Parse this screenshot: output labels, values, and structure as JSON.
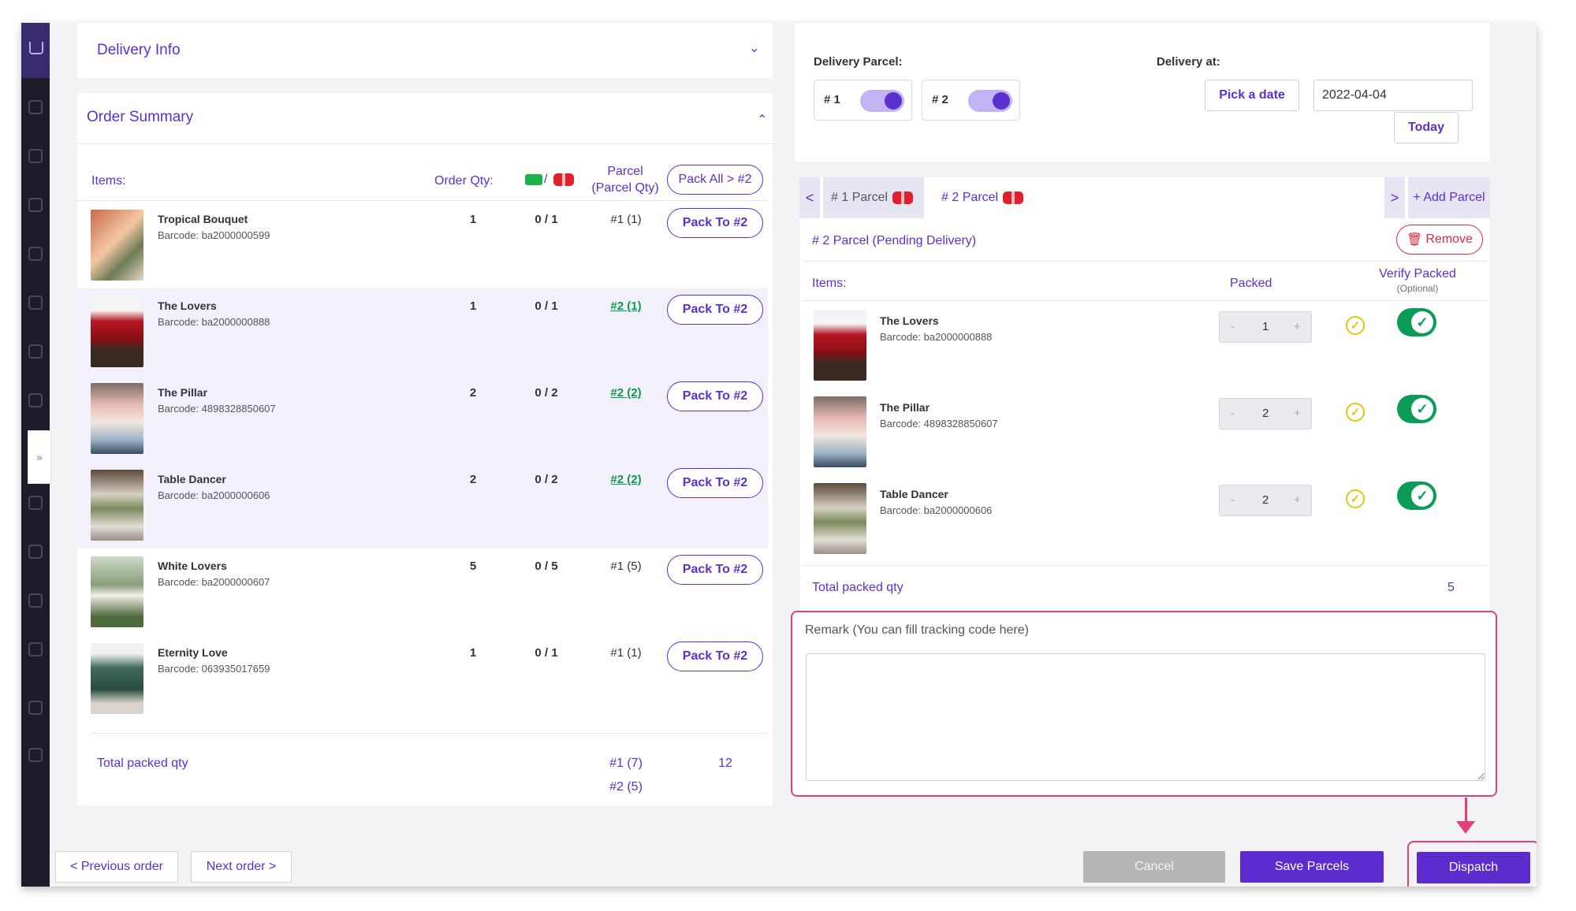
{
  "delivery_info": {
    "title": "Delivery Info"
  },
  "order_summary": {
    "title": "Order Summary",
    "headers": {
      "items": "Items:",
      "order_qty": "Order Qty:",
      "slash": "/",
      "parcel": "Parcel",
      "parcel_qty": "(Parcel Qty)"
    },
    "pack_all_label": "Pack All > #2",
    "items": [
      {
        "name": "Tropical Bouquet",
        "barcode": "Barcode: ba2000000599",
        "qty": "1",
        "packed": "0 / 1",
        "parcel": "#1 (1)",
        "pack_label": "Pack To #2"
      },
      {
        "name": "The Lovers",
        "barcode": "Barcode: ba2000000888",
        "qty": "1",
        "packed": "0 / 1",
        "parcel": "#2 (1)",
        "pack_label": "Pack To #2"
      },
      {
        "name": "The Pillar",
        "barcode": "Barcode: 4898328850607",
        "qty": "2",
        "packed": "0 / 2",
        "parcel": "#2 (2)",
        "pack_label": "Pack To #2"
      },
      {
        "name": "Table Dancer",
        "barcode": "Barcode: ba2000000606",
        "qty": "2",
        "packed": "0 / 2",
        "parcel": "#2 (2)",
        "pack_label": "Pack To #2"
      },
      {
        "name": "White Lovers",
        "barcode": "Barcode: ba2000000607",
        "qty": "5",
        "packed": "0 / 5",
        "parcel": "#1 (5)",
        "pack_label": "Pack To #2"
      },
      {
        "name": "Eternity Love",
        "barcode": "Barcode: 063935017659",
        "qty": "1",
        "packed": "0 / 1",
        "parcel": "#1 (1)",
        "pack_label": "Pack To #2"
      }
    ],
    "total_label": "Total packed qty",
    "total_parcel_1": "#1 (7)",
    "total_parcel_2": "#2 (5)",
    "total_value": "12"
  },
  "delivery": {
    "parcel_label": "Delivery Parcel:",
    "toggle_1": "# 1",
    "toggle_2": "# 2",
    "at_label": "Delivery at:",
    "pick_date": "Pick a date",
    "date_value": "2022-04-04",
    "today": "Today"
  },
  "parcels": {
    "tab_1": "# 1 Parcel",
    "tab_2": "# 2 Parcel",
    "add_parcel": "+ Add Parcel",
    "prev_symbol": "<",
    "next_symbol": ">",
    "status": "# 2 Parcel (Pending Delivery)",
    "remove": "Remove",
    "headers": {
      "items": "Items:",
      "packed": "Packed",
      "verify": "Verify Packed",
      "optional": "(Optional)"
    },
    "items": [
      {
        "name": "The Lovers",
        "barcode": "Barcode: ba2000000888",
        "packed": "1"
      },
      {
        "name": "The Pillar",
        "barcode": "Barcode: 4898328850607",
        "packed": "2"
      },
      {
        "name": "Table Dancer",
        "barcode": "Barcode: ba2000000606",
        "packed": "2"
      }
    ],
    "minus": "-",
    "plus": "+",
    "total_label": "Total packed qty",
    "total_value": "5"
  },
  "remark": {
    "label": "Remark (You can fill tracking code here)",
    "value": ""
  },
  "footer": {
    "prev_order": "< Previous order",
    "next_order": "Next order >",
    "cancel": "Cancel",
    "save": "Save Parcels",
    "dispatch": "Dispatch"
  },
  "colors": {
    "accent": "#5b2fd0",
    "success": "#0b9d58",
    "highlight": "#e1407a",
    "danger": "#e0283f"
  }
}
